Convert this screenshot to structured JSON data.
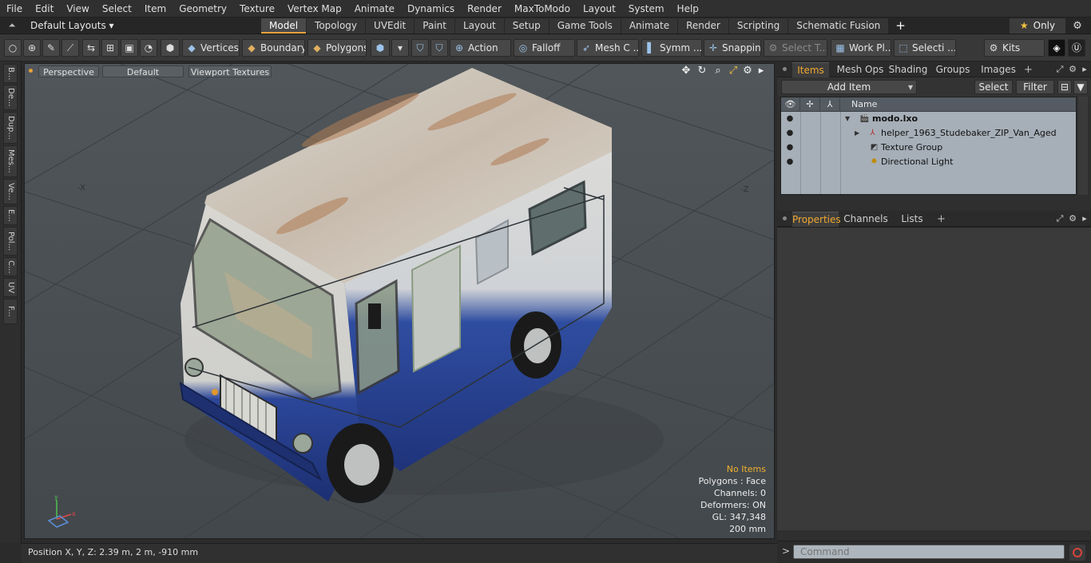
{
  "menu": [
    "File",
    "Edit",
    "View",
    "Select",
    "Item",
    "Geometry",
    "Texture",
    "Vertex Map",
    "Animate",
    "Dynamics",
    "Render",
    "MaxToModo",
    "Layout",
    "System",
    "Help"
  ],
  "layout_selector": "Default Layouts ▾",
  "tabs": [
    "Model",
    "Topology",
    "UVEdit",
    "Paint",
    "Layout",
    "Setup",
    "Game Tools",
    "Animate",
    "Render",
    "Scripting",
    "Schematic Fusion"
  ],
  "active_tab": "Model",
  "only_label": "Only",
  "toolbar": {
    "vertices": "Vertices",
    "boundary": "Boundary",
    "polygons": "Polygons",
    "action": "Action",
    "falloff": "Falloff",
    "mesh_c": "Mesh C ...",
    "symm": "Symm ...",
    "snapping": "Snapping",
    "select_t": "Select T...",
    "work_pl": "Work Pl...",
    "selecti": "Selecti ...",
    "kits": "Kits"
  },
  "left_tabs": [
    "B...",
    "De...",
    "Dup...",
    "Mes...",
    "Ve...",
    "E...",
    "Pol...",
    "C...",
    "UV",
    "F..."
  ],
  "viewport": {
    "view_mode": "Perspective",
    "shading": "Default",
    "textures": "Viewport Textures",
    "hud": {
      "no_items": "No Items",
      "polygons": "Polygons : Face",
      "channels": "Channels: 0",
      "deformers": "Deformers: ON",
      "gl": "GL: 347,348",
      "scale": "200 mm"
    }
  },
  "items_panel": {
    "tabs": [
      "Items",
      "Mesh Ops",
      "Shading",
      "Groups",
      "Images"
    ],
    "add_item": "Add Item",
    "select": "Select",
    "filter": "Filter",
    "name_header": "Name",
    "rows": [
      {
        "label": "modo.lxo",
        "bold": true
      },
      {
        "label": "helper_1963_Studebaker_ZIP_Van_Aged"
      },
      {
        "label": "Texture Group"
      },
      {
        "label": "Directional Light"
      }
    ]
  },
  "props_panel": {
    "tabs": [
      "Properties",
      "Channels",
      "Lists"
    ]
  },
  "status": "Position X, Y, Z:   2.39 m, 2 m, -910 mm",
  "command_placeholder": "Command"
}
